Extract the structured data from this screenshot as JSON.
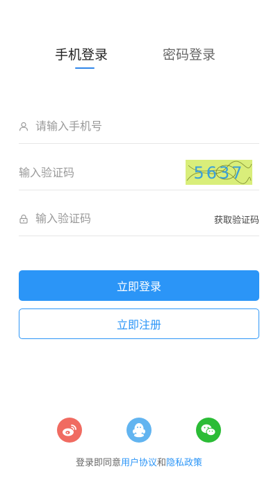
{
  "tabs": {
    "phone_login": "手机登录",
    "password_login": "密码登录"
  },
  "form": {
    "phone_placeholder": "请输入手机号",
    "captcha_placeholder": "输入验证码",
    "captcha_text": "5637",
    "sms_placeholder": "输入验证码",
    "get_code_label": "获取验证码"
  },
  "buttons": {
    "login_label": "立即登录",
    "register_label": "立即注册"
  },
  "social": {
    "icons": [
      "weibo-icon",
      "qq-icon",
      "wechat-icon"
    ]
  },
  "agreement": {
    "prefix": "登录即同意",
    "user_agreement": "用户协议",
    "and": "和",
    "privacy_policy": "隐私政策"
  },
  "colors": {
    "primary": "#2b95f7",
    "weibo": "#f06b61",
    "qq": "#62b4f0",
    "wechat": "#2bbc36"
  }
}
